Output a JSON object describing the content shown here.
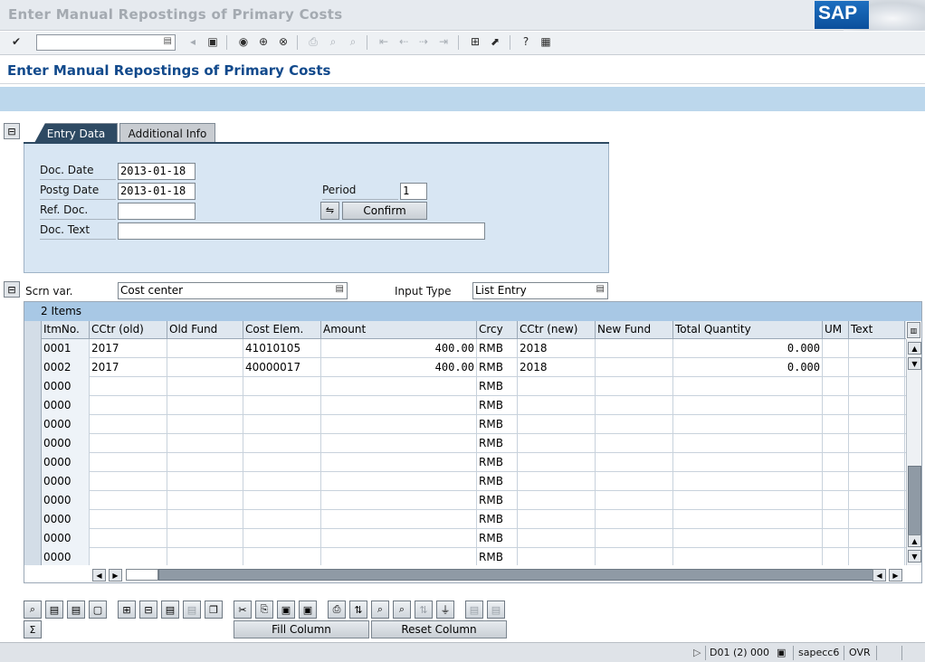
{
  "window": {
    "title": "Enter Manual Repostings of Primary Costs",
    "logo": "SAP"
  },
  "toolbar": {
    "command_value": "",
    "buttons": [
      "enter-icon",
      "back-arrow-icon",
      "save-icon",
      "back-icon",
      "exit-icon",
      "cancel-icon",
      "print-icon",
      "find-icon",
      "find-next-icon",
      "first-page-icon",
      "prev-page-icon",
      "next-page-icon",
      "last-page-icon",
      "new-session-icon",
      "shortcut-icon",
      "help-icon",
      "layout-menu-icon"
    ]
  },
  "page": {
    "title": "Enter Manual Repostings of Primary Costs"
  },
  "tabs": [
    {
      "label": "Entry Data"
    },
    {
      "label": "Additional Info"
    }
  ],
  "entry": {
    "doc_date": {
      "label": "Doc. Date",
      "value": "2013-01-18"
    },
    "postg_date": {
      "label": "Postg Date",
      "value": "2013-01-18"
    },
    "ref_doc": {
      "label": "Ref. Doc.",
      "value": ""
    },
    "doc_text": {
      "label": "Doc. Text",
      "value": ""
    },
    "period": {
      "label": "Period",
      "value": "1"
    },
    "confirm_label": "Confirm"
  },
  "screen_variant": {
    "label": "Scrn var.",
    "value": "Cost center"
  },
  "input_type": {
    "label": "Input Type",
    "value": "List Entry"
  },
  "grid": {
    "title": "2 Items",
    "columns": [
      "ItmNo.",
      "CCtr (old)",
      "Old Fund",
      "Cost Elem.",
      "Amount",
      "Crcy",
      "CCtr (new)",
      "New Fund",
      "Total Quantity",
      "UM",
      "Text"
    ],
    "rows": [
      [
        "0001",
        "2017",
        "",
        "41010105",
        "400.00",
        "RMB",
        "2018",
        "",
        "0.000",
        "",
        ""
      ],
      [
        "0002",
        "2017",
        "",
        "40000017",
        "400.00",
        "RMB",
        "2018",
        "",
        "0.000",
        "",
        ""
      ],
      [
        "0000",
        "",
        "",
        "",
        "",
        "RMB",
        "",
        "",
        "",
        "",
        ""
      ],
      [
        "0000",
        "",
        "",
        "",
        "",
        "RMB",
        "",
        "",
        "",
        "",
        ""
      ],
      [
        "0000",
        "",
        "",
        "",
        "",
        "RMB",
        "",
        "",
        "",
        "",
        ""
      ],
      [
        "0000",
        "",
        "",
        "",
        "",
        "RMB",
        "",
        "",
        "",
        "",
        ""
      ],
      [
        "0000",
        "",
        "",
        "",
        "",
        "RMB",
        "",
        "",
        "",
        "",
        ""
      ],
      [
        "0000",
        "",
        "",
        "",
        "",
        "RMB",
        "",
        "",
        "",
        "",
        ""
      ],
      [
        "0000",
        "",
        "",
        "",
        "",
        "RMB",
        "",
        "",
        "",
        "",
        ""
      ],
      [
        "0000",
        "",
        "",
        "",
        "",
        "RMB",
        "",
        "",
        "",
        "",
        ""
      ],
      [
        "0000",
        "",
        "",
        "",
        "",
        "RMB",
        "",
        "",
        "",
        "",
        ""
      ],
      [
        "0000",
        "",
        "",
        "",
        "",
        "RMB",
        "",
        "",
        "",
        "",
        ""
      ]
    ]
  },
  "bottom": {
    "fill_column": "Fill Column",
    "reset_column": "Reset Column"
  },
  "status": {
    "system": "D01 (2) 000",
    "server": "sapecc6",
    "mode": "OVR"
  }
}
